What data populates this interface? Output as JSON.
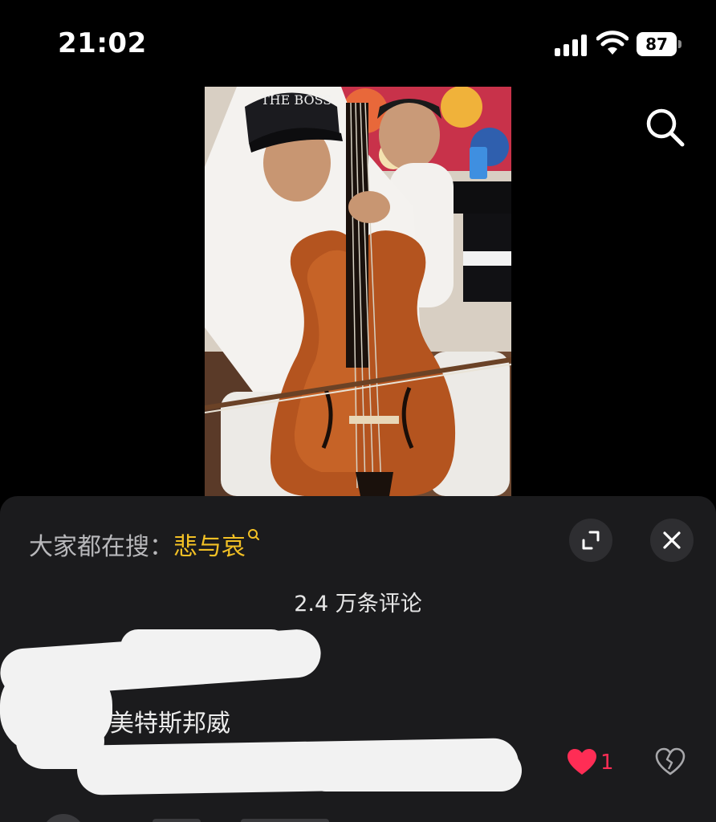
{
  "status_bar": {
    "time": "21:02",
    "battery": "87",
    "icons": [
      "cellular-signal-icon",
      "wifi-icon",
      "battery-icon"
    ]
  },
  "video": {
    "description_icon": "video-frame",
    "search_icon": "search-icon"
  },
  "comment_sheet": {
    "hot_search_prefix": "大家都在搜：",
    "hot_search_keyword": "悲与哀",
    "expand_icon": "expand-icon",
    "close_icon": "close-icon",
    "comment_count": "2.4 万条评论",
    "comments": [
      {
        "username": "美特斯邦威",
        "likes": "1",
        "like_icon": "heart-icon",
        "dislike_icon": "broken-heart-icon"
      }
    ]
  },
  "colors": {
    "background": "#000000",
    "sheet_background": "#1b1b1d",
    "keyword": "#f2c025",
    "like": "#ff2d55"
  }
}
